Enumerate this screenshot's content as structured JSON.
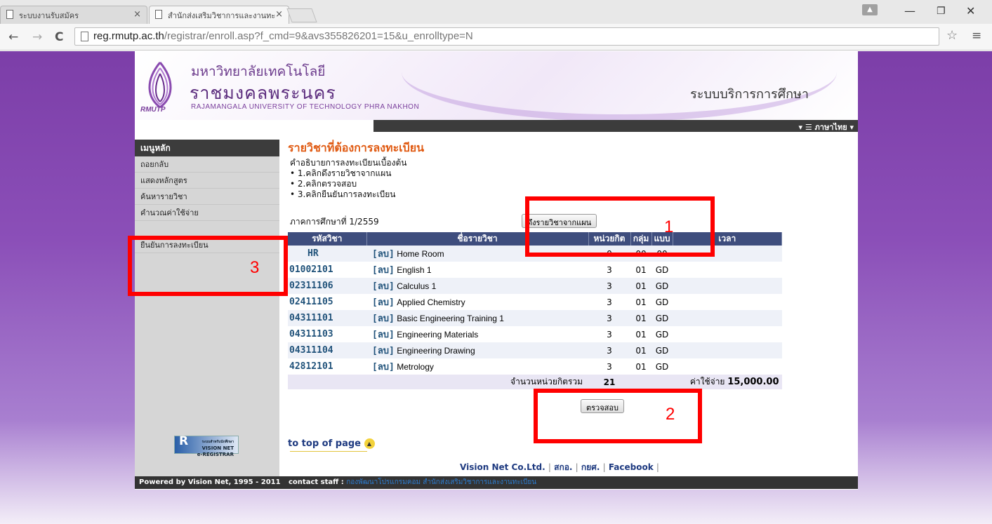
{
  "browser": {
    "tabs": [
      {
        "title": "ระบบงานรับสมัคร",
        "active": false
      },
      {
        "title": "สำนักส่งเสริมวิชาการและงานทะ",
        "active": true
      }
    ],
    "url_host": "reg.rmutp.ac.th",
    "url_path": "/registrar/enroll.asp?f_cmd=9&avs355826201=15&u_enrolltype=N"
  },
  "header": {
    "uni_th_line1": "มหาวิทยาลัยเทคโนโลยี",
    "uni_th_line2": "ราชมงคลพระนคร",
    "uni_en": "RAJAMANGALA UNIVERSITY OF TECHNOLOGY PHRA NAKHON",
    "logo_text": "RMUTP",
    "system_title": "ระบบบริการการศึกษา",
    "language": "▾ ☰ ภาษาไทย ▾"
  },
  "sidebar": {
    "heading": "เมนูหลัก",
    "items": [
      {
        "label": "ถอยกลับ"
      },
      {
        "label": "แสดงหลักสูตร"
      },
      {
        "label": "ค้นหารายวิชา"
      },
      {
        "label": "คำนวณค่าใช้จ่าย"
      },
      {
        "label": ""
      },
      {
        "label": "ยืนยันการลงทะเบียน"
      }
    ],
    "badge_top": "ระบบสำหรับนักศึกษา",
    "badge_main": "VISION NET",
    "badge_sub": "e-REGISTRAR",
    "badge_r": "R"
  },
  "main": {
    "title": "รายวิชาที่ต้องการลงทะเบียน",
    "instructions_title": "คำอธิบายการลงทะเบียนเบื้องต้น",
    "steps": [
      "• 1.คลิกดึงรายวิชาจากแผน",
      "• 2.คลิกตรวจสอบ",
      "• 3.คลิกยืนยันการลงทะเบียน"
    ],
    "semester": "ภาคการศึกษาที่ 1/2559",
    "pull_button": "ดึงรายวิชาจากแผน",
    "check_button": "ตรวจสอบ",
    "columns": [
      "รหัสวิชา",
      "ชื่อรายวิชา",
      "หน่วยกิต",
      "กลุ่ม",
      "แบบ",
      "เวลา"
    ],
    "drop_label": "[ลบ]",
    "rows": [
      {
        "code": "HR",
        "name": "Home Room",
        "credit": "0",
        "group": "00",
        "type": "00"
      },
      {
        "code": "01002101",
        "name": "English 1",
        "credit": "3",
        "group": "01",
        "type": "GD"
      },
      {
        "code": "02311106",
        "name": "Calculus 1",
        "credit": "3",
        "group": "01",
        "type": "GD"
      },
      {
        "code": "02411105",
        "name": "Applied Chemistry",
        "credit": "3",
        "group": "01",
        "type": "GD"
      },
      {
        "code": "04311101",
        "name": "Basic Engineering Training 1",
        "credit": "3",
        "group": "01",
        "type": "GD"
      },
      {
        "code": "04311103",
        "name": "Engineering Materials",
        "credit": "3",
        "group": "01",
        "type": "GD"
      },
      {
        "code": "04311104",
        "name": "Engineering Drawing",
        "credit": "3",
        "group": "01",
        "type": "GD"
      },
      {
        "code": "42812101",
        "name": "Metrology",
        "credit": "3",
        "group": "01",
        "type": "GD"
      }
    ],
    "total_label": "จำนวนหน่วยกิตรวม",
    "total_credits": "21",
    "cost_label": "ค่าใช้จ่าย",
    "cost_value": "15,000.00",
    "top_link": "to top of page"
  },
  "footer": {
    "links": [
      "Vision Net Co.Ltd.",
      "สกอ.",
      "กยศ.",
      "Facebook"
    ],
    "powered": "Powered by Vision Net, 1995 - 2011",
    "contact_label": "contact staff :",
    "contact_value": "กองพัฒนาโปรแกรมคอม สำนักส่งเสริมวิชาการและงานทะเบียน"
  },
  "annotations": [
    {
      "label": "1",
      "color": "#ff0000"
    },
    {
      "label": "2",
      "color": "#ff0000"
    },
    {
      "label": "3",
      "color": "#ff0000"
    }
  ]
}
